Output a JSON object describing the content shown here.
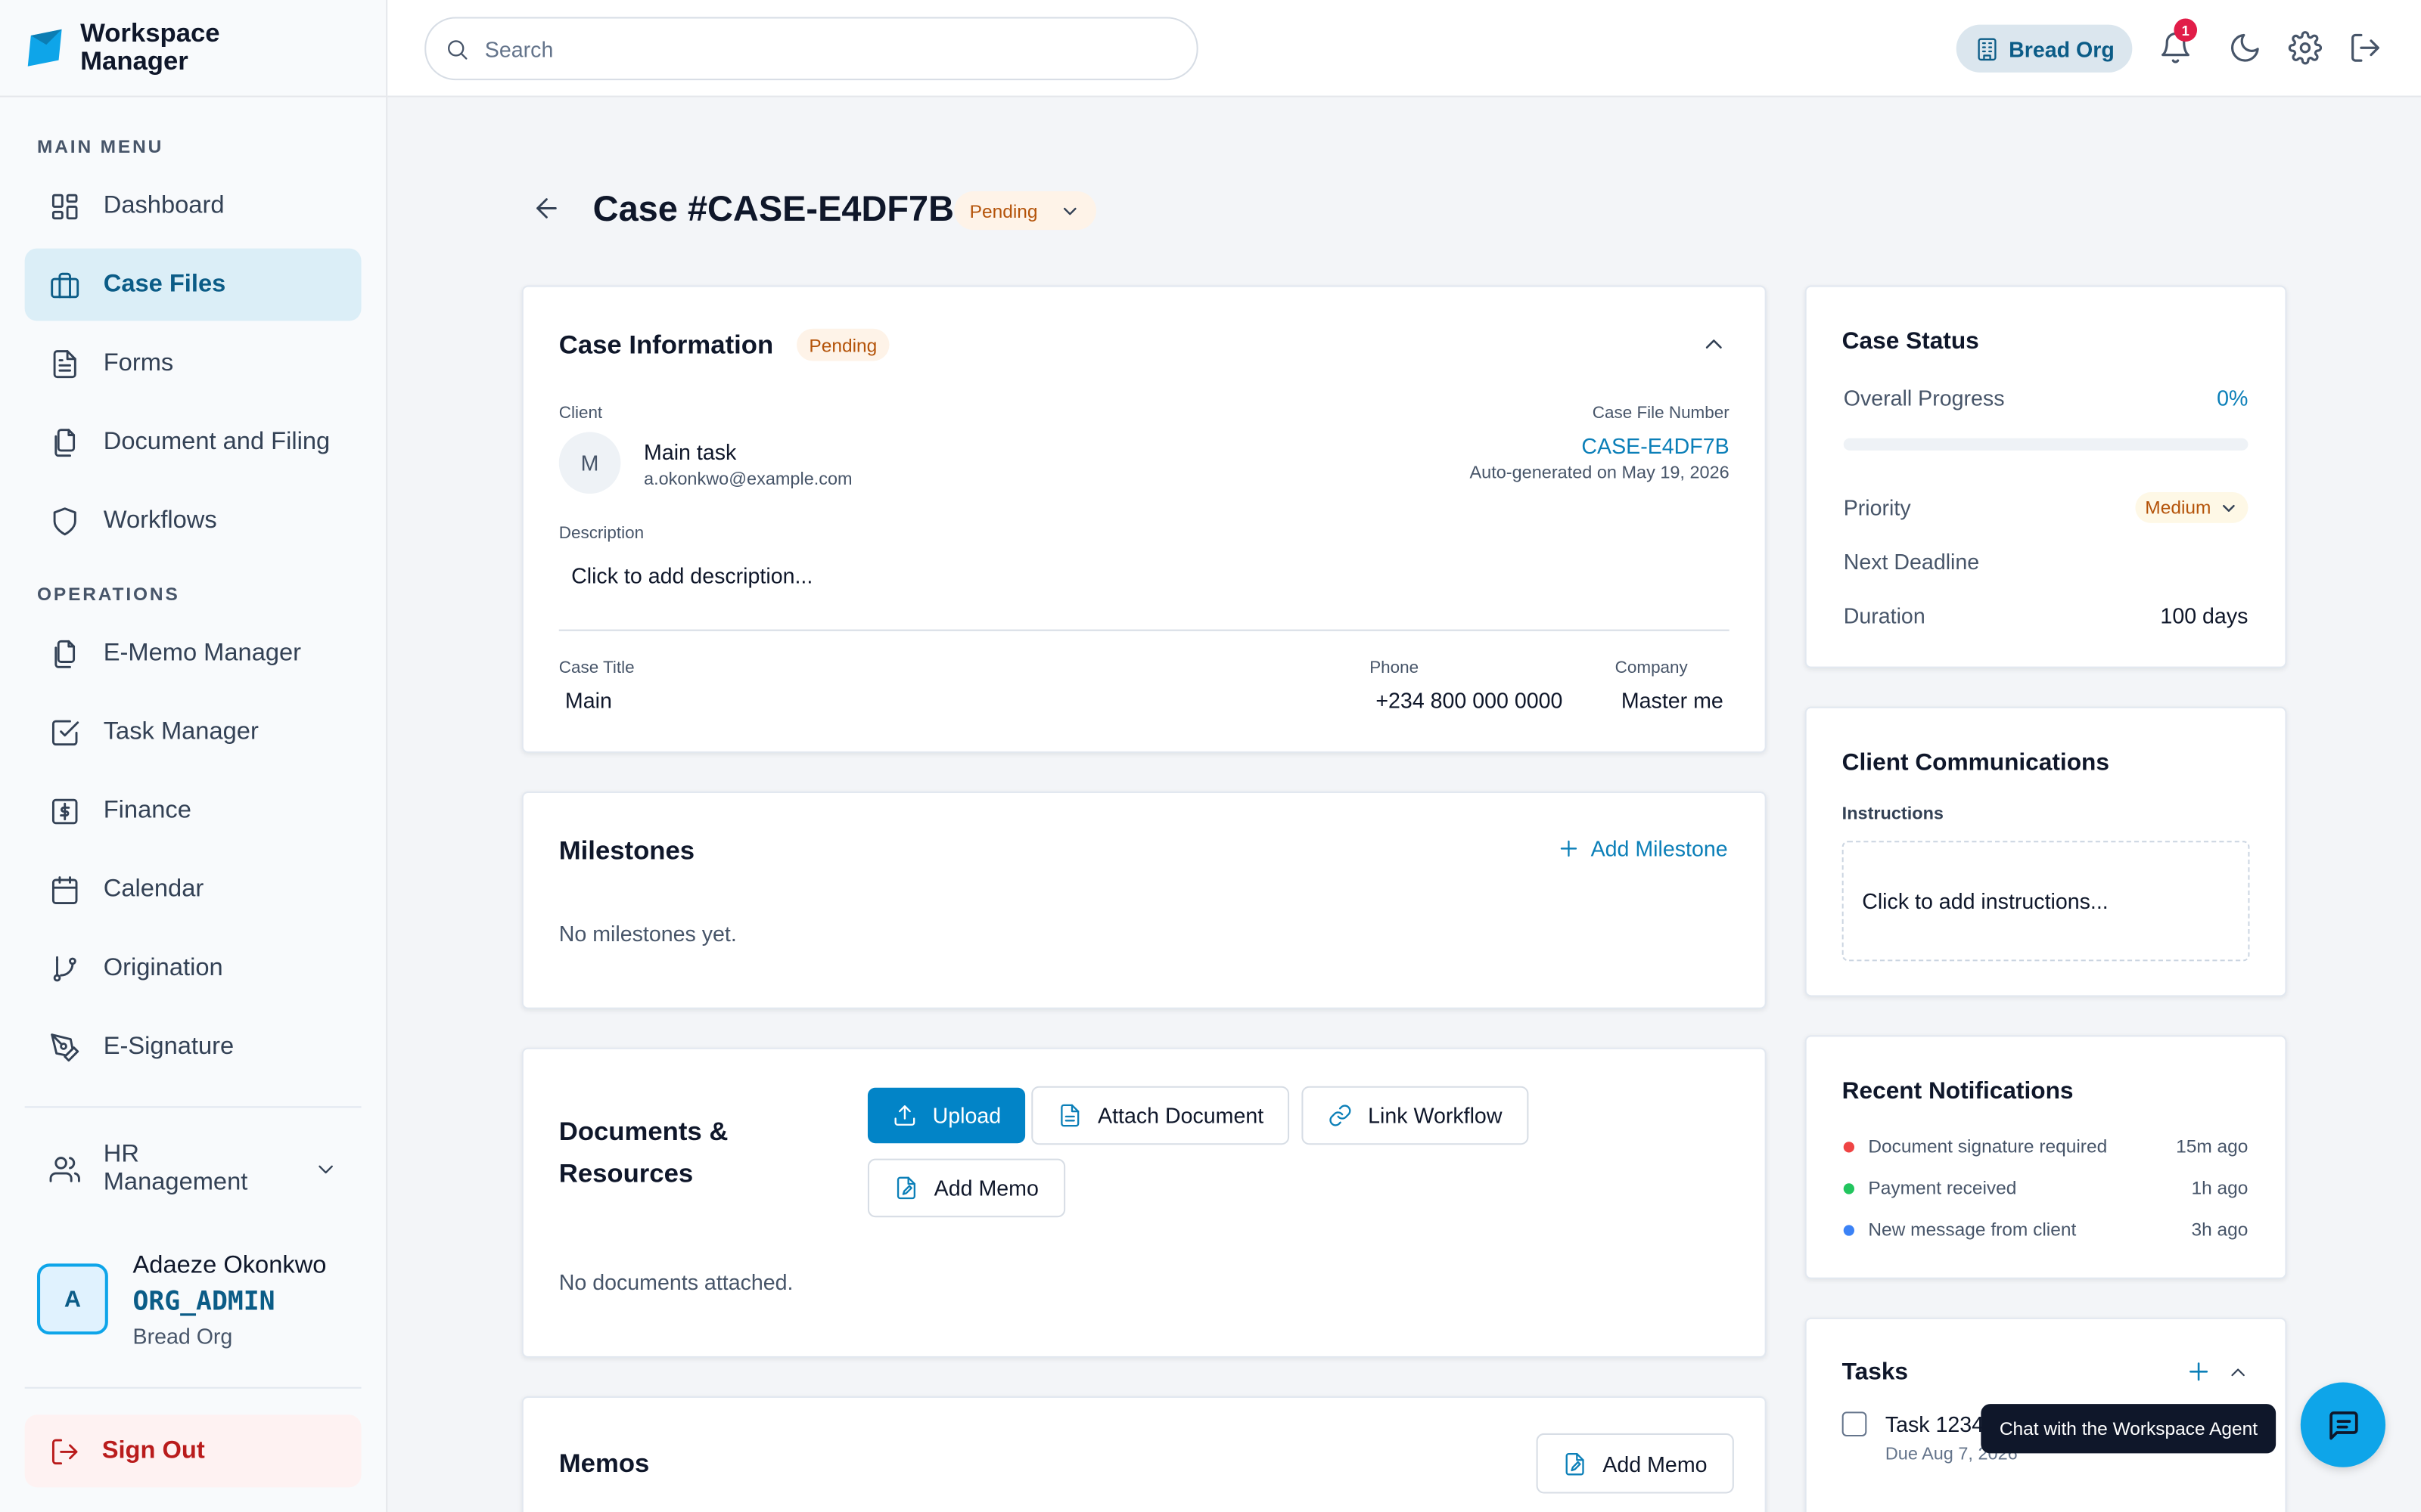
{
  "app": {
    "name_line1": "Workspace",
    "name_line2": "Manager"
  },
  "sidebar": {
    "main_menu_heading": "MAIN MENU",
    "main_items": [
      {
        "label": "Dashboard",
        "icon": "dashboard-icon"
      },
      {
        "label": "Case Files",
        "icon": "briefcase-icon",
        "active": true
      },
      {
        "label": "Forms",
        "icon": "form-icon"
      },
      {
        "label": "Document and Filing",
        "icon": "documents-icon"
      },
      {
        "label": "Workflows",
        "icon": "shield-icon"
      }
    ],
    "operations_heading": "OPERATIONS",
    "operations_items": [
      {
        "label": "E-Memo Manager",
        "icon": "memo-icon"
      },
      {
        "label": "Task Manager",
        "icon": "checkbox-icon"
      },
      {
        "label": "Finance",
        "icon": "dollar-icon"
      },
      {
        "label": "Calendar",
        "icon": "calendar-icon"
      },
      {
        "label": "Origination",
        "icon": "git-branch-icon"
      },
      {
        "label": "E-Signature",
        "icon": "pen-icon"
      }
    ],
    "hr_label": "HR Management",
    "user": {
      "initial": "A",
      "name": "Adaeze Okonkwo",
      "role": "ORG_ADMIN",
      "org": "Bread Org"
    },
    "sign_out": "Sign Out"
  },
  "topbar": {
    "search_placeholder": "Search",
    "org_label": "Bread Org",
    "notification_count": "1"
  },
  "header": {
    "title": "Case #CASE-E4DF7B",
    "status": "Pending"
  },
  "case_info": {
    "title": "Case Information",
    "status": "Pending",
    "client_label": "Client",
    "client_initial": "M",
    "client_name": "Main task",
    "client_email": "a.okonkwo@example.com",
    "case_number_label": "Case File Number",
    "case_number": "CASE-E4DF7B",
    "auto_generated": "Auto-generated on May 19, 2026",
    "description_label": "Description",
    "description_placeholder": "Click to add description...",
    "case_title_label": "Case Title",
    "case_title": "Main",
    "phone_label": "Phone",
    "phone": "+234 800 000 0000",
    "company_label": "Company",
    "company": "Master me"
  },
  "milestones": {
    "title": "Milestones",
    "add_label": "Add Milestone",
    "empty": "No milestones yet."
  },
  "documents": {
    "title_line1": "Documents &",
    "title_line2": "Resources",
    "upload": "Upload",
    "attach": "Attach Document",
    "link_workflow": "Link Workflow",
    "add_memo": "Add Memo",
    "empty": "No documents attached."
  },
  "memos": {
    "title": "Memos",
    "add_memo": "Add Memo"
  },
  "case_status": {
    "title": "Case Status",
    "progress_label": "Overall Progress",
    "progress_value": "0%",
    "progress_fraction": 0,
    "priority_label": "Priority",
    "priority_value": "Medium",
    "deadline_label": "Next Deadline",
    "duration_label": "Duration",
    "duration_value": "100 days"
  },
  "client_comms": {
    "title": "Client Communications",
    "instructions_label": "Instructions",
    "instructions_placeholder": "Click to add instructions..."
  },
  "notifications": {
    "title": "Recent Notifications",
    "items": [
      {
        "text": "Document signature required",
        "time": "15m ago",
        "color": "#ef4444"
      },
      {
        "text": "Payment received",
        "time": "1h ago",
        "color": "#22c55e"
      },
      {
        "text": "New message from client",
        "time": "3h ago",
        "color": "#3b82f6"
      }
    ]
  },
  "tasks": {
    "title": "Tasks",
    "item_label": "Task 12345",
    "item_due": "Due Aug 7, 2026"
  },
  "chat": {
    "tooltip": "Chat with the Workspace Agent"
  },
  "colors": {
    "accent": "#0284c7",
    "active_bg": "#dbeef7",
    "pending_text": "#b45309",
    "danger": "#b91c1c"
  }
}
